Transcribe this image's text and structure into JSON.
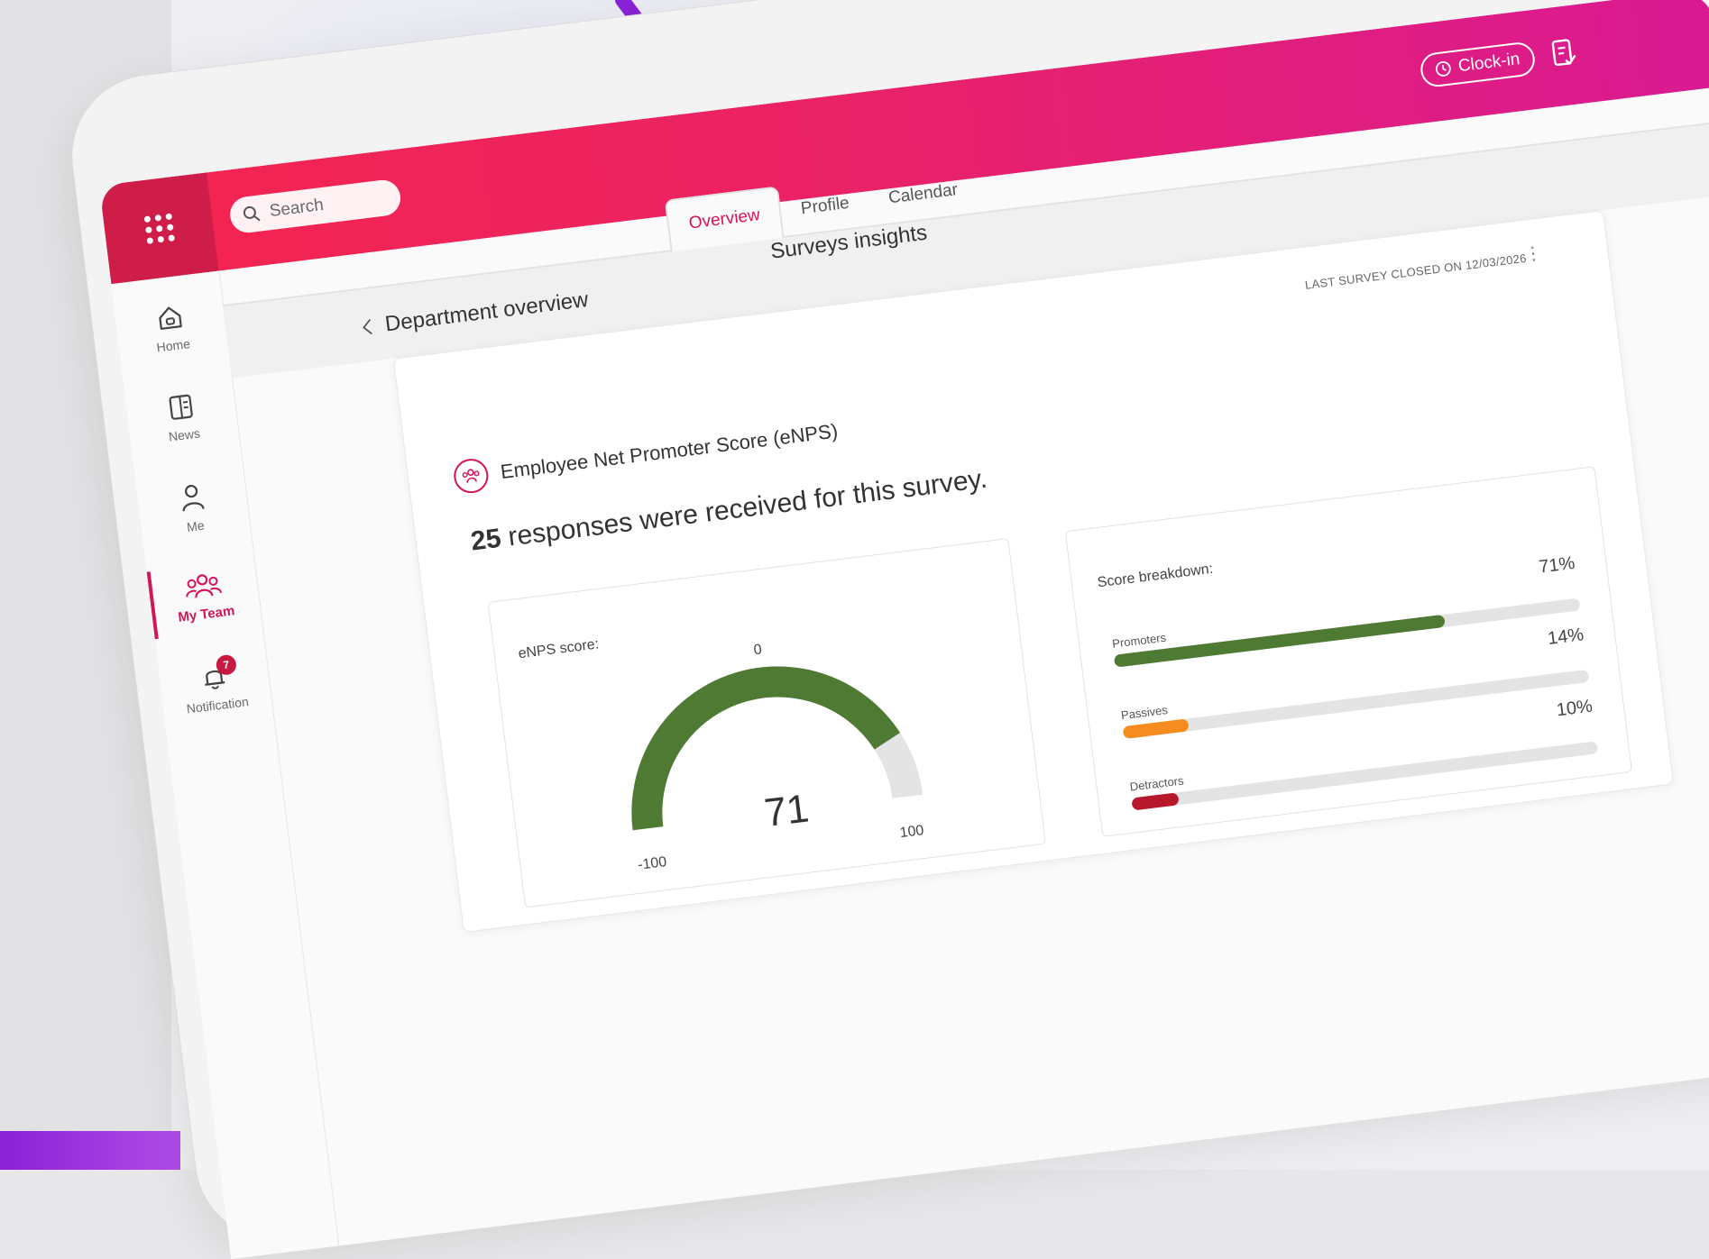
{
  "topbar": {
    "search_placeholder": "Search",
    "clockin_label": "Clock-in"
  },
  "sidebar": {
    "items": [
      {
        "label": "Home",
        "icon": "home-icon"
      },
      {
        "label": "News",
        "icon": "news-icon"
      },
      {
        "label": "Me",
        "icon": "person-icon"
      },
      {
        "label": "My Team",
        "icon": "team-icon",
        "active": true
      },
      {
        "label": "Notification",
        "icon": "bell-icon",
        "badge": "7"
      }
    ]
  },
  "tabs": [
    {
      "label": "Overview",
      "active": true
    },
    {
      "label": "Profile"
    },
    {
      "label": "Calendar"
    }
  ],
  "page": {
    "title": "Surveys insights",
    "breadcrumb": "Department overview",
    "last_survey": "LAST SURVEY CLOSED ON 12/03/2026"
  },
  "enps": {
    "title": "Employee Net Promoter Score (eNPS)",
    "responses_count": "25",
    "responses_text": " responses were received for this survey.",
    "gauge": {
      "label": "eNPS score:",
      "score": 71,
      "score_text": "71",
      "min": -100,
      "max": 100,
      "min_label": "-100",
      "mid_label": "0",
      "max_label": "100"
    },
    "breakdown": {
      "title": "Score breakdown:",
      "rows": [
        {
          "name": "Promoters",
          "percent": 71,
          "percent_label": "71%",
          "color": "#4e7a34"
        },
        {
          "name": "Passives",
          "percent": 14,
          "percent_label": "14%",
          "color": "#f68b1f"
        },
        {
          "name": "Detractors",
          "percent": 10,
          "percent_label": "10%",
          "color": "#b8182b"
        }
      ]
    }
  },
  "colors": {
    "brand": "#e8215e",
    "accent": "#d4145a",
    "gauge_fill": "#4e7a34",
    "gauge_track": "#e4e4e4"
  }
}
